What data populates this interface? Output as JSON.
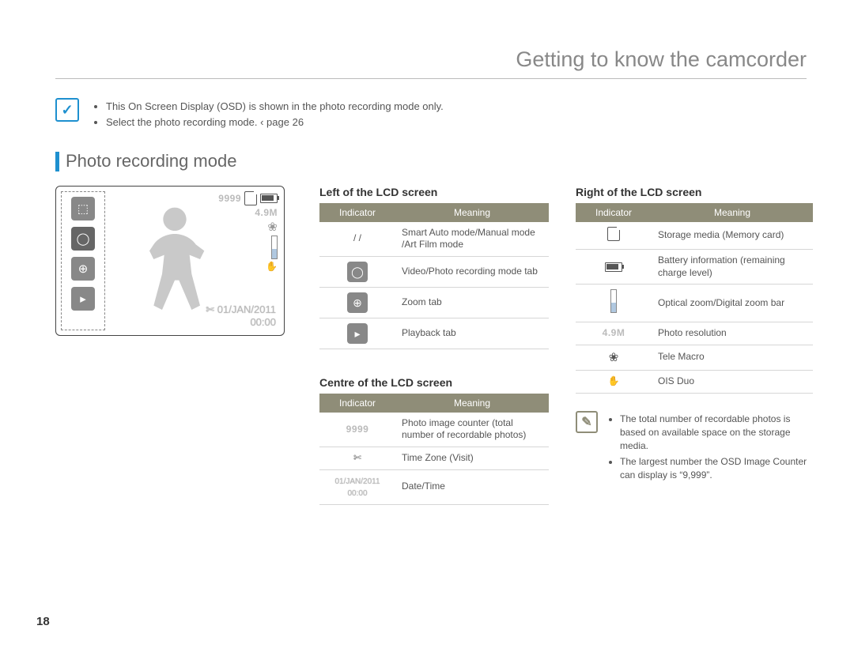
{
  "header": {
    "title": "Getting to know the camcorder"
  },
  "top_note": {
    "items": [
      "This On Screen Display (OSD) is shown in the photo recording mode only.",
      "Select the photo recording mode.  ‹ page 26"
    ]
  },
  "section": {
    "title": "Photo recording mode"
  },
  "lcd": {
    "counter": "9999",
    "res": "4.9M",
    "date": "01/JAN/2011",
    "time": "00:00"
  },
  "left_table": {
    "heading": "Left of the LCD screen",
    "th1": "Indicator",
    "th2": "Meaning",
    "rows": [
      {
        "ic": "/   /",
        "mean": "Smart Auto mode/Manual mode /Art Film mode"
      },
      {
        "ic": "tab-camera",
        "mean": "Video/Photo recording mode tab"
      },
      {
        "ic": "tab-zoom",
        "mean": "Zoom tab"
      },
      {
        "ic": "tab-play",
        "mean": "Playback tab"
      }
    ]
  },
  "centre_table": {
    "heading": "Centre of the LCD screen",
    "th1": "Indicator",
    "th2": "Meaning",
    "rows": [
      {
        "ic": "9999",
        "mean": "Photo image counter (total number of recordable photos)"
      },
      {
        "ic": "✄",
        "mean": "Time Zone (Visit)"
      },
      {
        "ic": "01/JAN/2011\n00:00",
        "mean": "Date/Time"
      }
    ]
  },
  "right_table": {
    "heading": "Right of the LCD screen",
    "th1": "Indicator",
    "th2": "Meaning",
    "rows": [
      {
        "ic": "sd",
        "mean": "Storage media (Memory card)"
      },
      {
        "ic": "batt",
        "mean": "Battery information (remaining charge level)"
      },
      {
        "ic": "zoombar",
        "mean": "Optical zoom/Digital zoom bar"
      },
      {
        "ic": "4.9M",
        "mean": "Photo resolution"
      },
      {
        "ic": "❀",
        "mean": "Tele Macro"
      },
      {
        "ic": "✋",
        "mean": "OIS Duo"
      }
    ]
  },
  "right_note": {
    "items": [
      "The total number of recordable photos is based on available space on the storage media.",
      "The largest number the OSD Image Counter can display is “9,999”."
    ]
  },
  "page_number": "18"
}
